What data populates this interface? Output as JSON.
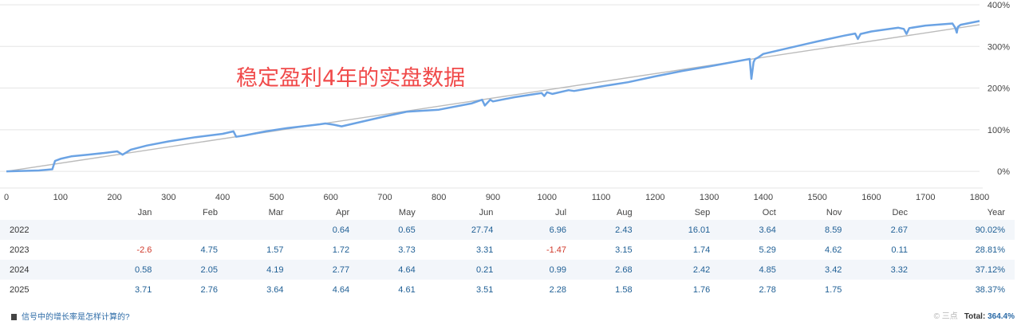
{
  "overlay_text": "稳定盈利4年的实盘数据",
  "chart_data": {
    "type": "line",
    "x_ticks": [
      "0",
      "100",
      "200",
      "300",
      "400",
      "500",
      "600",
      "700",
      "800",
      "900",
      "1000",
      "1100",
      "1200",
      "1300",
      "1400",
      "1500",
      "1600",
      "1700",
      "1800"
    ],
    "y_ticks": [
      "0%",
      "100%",
      "200%",
      "300%",
      "400%"
    ],
    "xlim": [
      0,
      1800
    ],
    "ylim": [
      -40,
      400
    ],
    "grid": true,
    "series": [
      {
        "color": "#6ba3e4",
        "x": [
          0,
          60,
          85,
          90,
          100,
          120,
          150,
          180,
          205,
          215,
          220,
          230,
          260,
          300,
          350,
          400,
          420,
          425,
          440,
          480,
          520,
          560,
          580,
          590,
          605,
          620,
          660,
          700,
          740,
          800,
          860,
          880,
          885,
          895,
          900,
          940,
          970,
          990,
          995,
          1000,
          1010,
          1040,
          1050,
          1100,
          1150,
          1200,
          1250,
          1300,
          1350,
          1375,
          1378,
          1382,
          1385,
          1390,
          1400,
          1450,
          1500,
          1550,
          1570,
          1575,
          1580,
          1600,
          1650,
          1660,
          1665,
          1670,
          1700,
          1750,
          1755,
          1758,
          1760,
          1765,
          1800
        ],
        "y": [
          0,
          2,
          5,
          25,
          30,
          36,
          40,
          44,
          48,
          40,
          44,
          52,
          62,
          72,
          82,
          90,
          96,
          83,
          86,
          96,
          104,
          110,
          113,
          115,
          112,
          108,
          120,
          132,
          143,
          148,
          163,
          172,
          158,
          172,
          168,
          178,
          184,
          188,
          181,
          190,
          186,
          195,
          193,
          204,
          214,
          228,
          241,
          252,
          264,
          270,
          222,
          262,
          270,
          273,
          282,
          297,
          312,
          326,
          331,
          318,
          330,
          336,
          345,
          342,
          330,
          344,
          350,
          355,
          345,
          333,
          347,
          352,
          361
        ]
      },
      {
        "color": "#bbbbbb",
        "x": [
          0,
          1800
        ],
        "y": [
          0,
          352
        ]
      }
    ]
  },
  "table": {
    "headers": [
      "",
      "Jan",
      "Feb",
      "Mar",
      "Apr",
      "May",
      "Jun",
      "Jul",
      "Aug",
      "Sep",
      "Oct",
      "Nov",
      "Dec",
      "Year"
    ],
    "rows": [
      {
        "year": "2022",
        "cells": [
          "",
          "",
          "",
          "0.64",
          "0.65",
          "27.74",
          "6.96",
          "2.43",
          "16.01",
          "3.64",
          "8.59",
          "2.67",
          "90.02%"
        ]
      },
      {
        "year": "2023",
        "cells": [
          "-2.6",
          "4.75",
          "1.57",
          "1.72",
          "3.73",
          "3.31",
          "-1.47",
          "3.15",
          "1.74",
          "5.29",
          "4.62",
          "0.11",
          "28.81%"
        ]
      },
      {
        "year": "2024",
        "cells": [
          "0.58",
          "2.05",
          "4.19",
          "2.77",
          "4.64",
          "0.21",
          "0.99",
          "2.68",
          "2.42",
          "4.85",
          "3.42",
          "3.32",
          "37.12%"
        ]
      },
      {
        "year": "2025",
        "cells": [
          "3.71",
          "2.76",
          "3.64",
          "4.64",
          "4.61",
          "3.51",
          "2.28",
          "1.58",
          "1.76",
          "2.78",
          "1.75",
          "",
          "38.37%"
        ]
      }
    ]
  },
  "footer": {
    "link_text": "信号中的增长率是怎样计算的?",
    "watermark": "© 三点",
    "total_label": "Total:",
    "total_value": "364.4%"
  }
}
